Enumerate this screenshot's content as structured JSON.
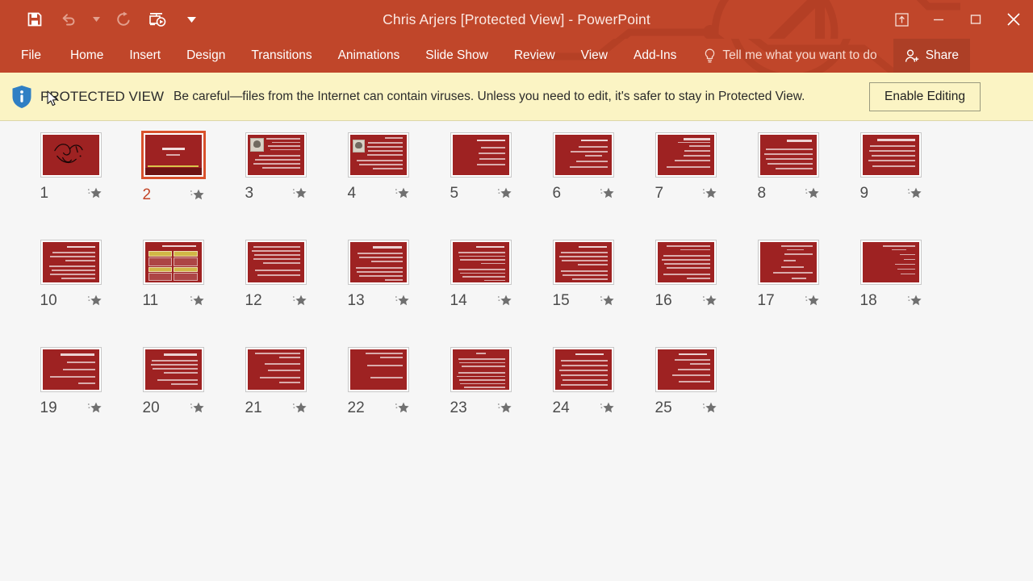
{
  "window": {
    "title": "Chris Arjers [Protected View] - PowerPoint",
    "accent_color": "#c0462a",
    "accent_dark": "#ad3f26",
    "quick_access": [
      {
        "name": "save-button",
        "icon": "save-icon",
        "enabled": true
      },
      {
        "name": "undo-button",
        "icon": "undo-icon",
        "enabled": false
      },
      {
        "name": "undo-dropdown-button",
        "icon": "chevron-down-icon",
        "enabled": false
      },
      {
        "name": "redo-button",
        "icon": "redo-icon",
        "enabled": false
      },
      {
        "name": "start-presentation-button",
        "icon": "start-slideshow-icon",
        "enabled": true
      },
      {
        "name": "customize-qat-button",
        "icon": "chevron-down-icon",
        "enabled": true
      }
    ],
    "controls": [
      {
        "name": "ribbon-display-options-button",
        "icon": "ribbon-display-icon",
        "label": ""
      },
      {
        "name": "minimize-button",
        "icon": "minimize-icon",
        "label": ""
      },
      {
        "name": "restore-button",
        "icon": "restore-icon",
        "label": ""
      },
      {
        "name": "close-button",
        "icon": "close-icon",
        "label": ""
      }
    ]
  },
  "ribbon": {
    "tabs": [
      {
        "label": "File"
      },
      {
        "label": "Home"
      },
      {
        "label": "Insert"
      },
      {
        "label": "Design"
      },
      {
        "label": "Transitions"
      },
      {
        "label": "Animations"
      },
      {
        "label": "Slide Show"
      },
      {
        "label": "Review"
      },
      {
        "label": "View"
      },
      {
        "label": "Add-Ins"
      }
    ],
    "tell_me": {
      "label": "Tell me what you want to do",
      "icon": "lightbulb-icon"
    },
    "share": {
      "label": "Share",
      "icon": "share-person-icon"
    }
  },
  "protected_view": {
    "icon": "info-shield-icon",
    "label": "PROTECTED VIEW",
    "message": "Be careful—files from the Internet can contain viruses. Unless you need to edit, it's safer to stay in Protected View.",
    "button_label": "Enable Editing",
    "bar_color": "#fbf4c4"
  },
  "slide_sorter": {
    "selected_slide": 2,
    "slide_fill": "#9e2222",
    "selection_color": "#d9512c",
    "star_icon": "star-icon",
    "slides": [
      {
        "number": "1",
        "layout": "calligraphy"
      },
      {
        "number": "2",
        "layout": "title"
      },
      {
        "number": "3",
        "layout": "photo-bullets"
      },
      {
        "number": "4",
        "layout": "photo-bullets"
      },
      {
        "number": "5",
        "layout": "bullets"
      },
      {
        "number": "6",
        "layout": "bullets"
      },
      {
        "number": "7",
        "layout": "bullets-dense"
      },
      {
        "number": "8",
        "layout": "paragraph"
      },
      {
        "number": "9",
        "layout": "paragraph"
      },
      {
        "number": "10",
        "layout": "paragraph"
      },
      {
        "number": "11",
        "layout": "table"
      },
      {
        "number": "12",
        "layout": "paragraph"
      },
      {
        "number": "13",
        "layout": "bullets"
      },
      {
        "number": "14",
        "layout": "bullets"
      },
      {
        "number": "15",
        "layout": "bullets"
      },
      {
        "number": "16",
        "layout": "paragraph"
      },
      {
        "number": "17",
        "layout": "centered-list"
      },
      {
        "number": "18",
        "layout": "centered-list"
      },
      {
        "number": "19",
        "layout": "bullets"
      },
      {
        "number": "20",
        "layout": "bullets"
      },
      {
        "number": "21",
        "layout": "bullets"
      },
      {
        "number": "22",
        "layout": "bullets"
      },
      {
        "number": "23",
        "layout": "bullets"
      },
      {
        "number": "24",
        "layout": "bullets"
      },
      {
        "number": "25",
        "layout": "bullets"
      }
    ]
  }
}
